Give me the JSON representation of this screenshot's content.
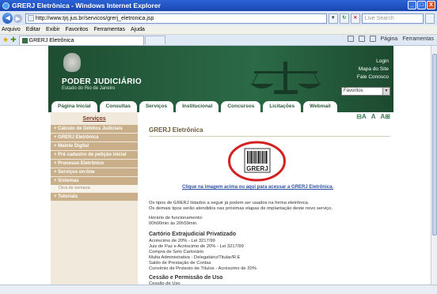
{
  "window": {
    "title": "GRERJ Eletrônica - Windows Internet Explorer",
    "min": "_",
    "max": "□",
    "close": "X"
  },
  "address": {
    "url": "http://www.tjrj.jus.br/servicos/grerj_eletronica.jsp",
    "search_placeholder": "Live Search"
  },
  "menu": [
    "Arquivo",
    "Editar",
    "Exibir",
    "Favoritos",
    "Ferramentas",
    "Ajuda"
  ],
  "tab": {
    "label": "GRERJ Eletrônica"
  },
  "toolbar": {
    "page": "Página",
    "tools": "Ferramentas"
  },
  "header": {
    "org": "PODER JUDICIÁRIO",
    "state": "Estado do Rio de Janeiro",
    "links": [
      "Login",
      "Mapa do Site",
      "Fale Conosco"
    ],
    "favorites_select": "Favoritos",
    "nav": [
      "Página Inicial",
      "Consultas",
      "Serviços",
      "Institucional",
      "Concursos",
      "Licitações",
      "Webmail"
    ]
  },
  "sidebar": {
    "title": "Serviços",
    "items": [
      "Cálculo de Débitos Judiciais",
      "GRERJ Eletrônica",
      "Malote Digital",
      "Pré cadastro de petição inicial",
      "Processo Eletrônico",
      "Serviços on-line",
      "Sistemas"
    ],
    "subitem": "Dica de semana",
    "last_item": "Tutoriais"
  },
  "main": {
    "font_controls": [
      "⊟A",
      "A",
      "A⊞"
    ],
    "title": "GRERJ Eletrônica",
    "logo_text": "GRERJ",
    "clique": "Clique na imagem acima ou aqui para acessar a GRERJ Eletrônica.",
    "p1": "Os tipos de GRERJ listados a seguir já podem ser usados na forma eletrônica.",
    "p2": "Os demais tipos serão atendidos nas próximas etapas de implantação deste novo serviço.",
    "horario_label": "Horário de funcionamento:",
    "horario_value": "00h00min às 20h59min.",
    "section1_title": "Cartório Extrajudicial Privatizado",
    "section1_items": [
      "Acréscimo de 20% - Lei 3217/99",
      "Juiz de Paz e Acréscimo de 20% - Lei 3217/99",
      "Compra de Selo Cartorário",
      "Multa Administrativa - Delegatário/Titular/R.E",
      "Saldo de Prestação de Contas",
      "Convênio de Protesto de Títulos - Acréscimo de 20%"
    ],
    "section2_title": "Cessão e Permissão de Uso",
    "section2_items": [
      "Cessão de Uso"
    ]
  }
}
